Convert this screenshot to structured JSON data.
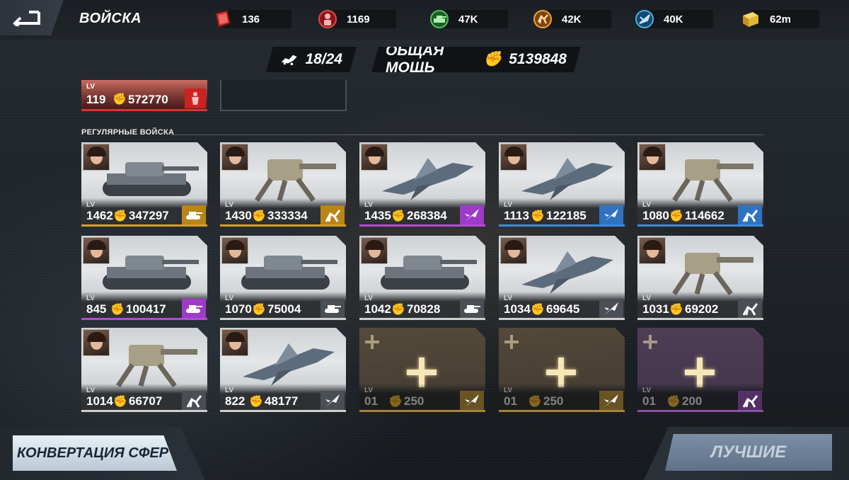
{
  "header": {
    "title": "ВОЙСКА",
    "resources": [
      {
        "name": "red-cube-resource",
        "value": "136",
        "color": "#d23b3b"
      },
      {
        "name": "red-soldier-resource",
        "value": "1169",
        "color": "#c8282e"
      },
      {
        "name": "green-tank-resource",
        "value": "47K",
        "color": "#2f9c3a"
      },
      {
        "name": "orange-mech-resource",
        "value": "42K",
        "color": "#d9851e"
      },
      {
        "name": "blue-jet-resource",
        "value": "40K",
        "color": "#2b8fd0"
      },
      {
        "name": "gold-box-resource",
        "value": "62m",
        "color": "#e0b53a"
      }
    ]
  },
  "summary": {
    "capacity": "18/24",
    "power_label": "ОБЩАЯ МОЩЬ",
    "power_value": "5139848"
  },
  "top_card": {
    "lvl_label": "LV",
    "level": "119",
    "power": "572770",
    "rarity": "red"
  },
  "section": {
    "label": "РЕГУЛЯРНЫЕ ВОЙСКА"
  },
  "units": [
    {
      "lvl_label": "LV",
      "level": "1462",
      "power": "347297",
      "rarity": "gold",
      "type": "tank-icon"
    },
    {
      "lvl_label": "LV",
      "level": "1430",
      "power": "333334",
      "rarity": "gold",
      "type": "mech-icon"
    },
    {
      "lvl_label": "LV",
      "level": "1435",
      "power": "268384",
      "rarity": "purple",
      "type": "jet-icon"
    },
    {
      "lvl_label": "LV",
      "level": "1113",
      "power": "122185",
      "rarity": "blue",
      "type": "jet-icon"
    },
    {
      "lvl_label": "LV",
      "level": "1080",
      "power": "114662",
      "rarity": "blue",
      "type": "mech-icon"
    },
    {
      "lvl_label": "LV",
      "level": "845",
      "power": "100417",
      "rarity": "purple",
      "type": "tank-icon"
    },
    {
      "lvl_label": "LV",
      "level": "1070",
      "power": "75004",
      "rarity": "gray",
      "type": "tank-icon"
    },
    {
      "lvl_label": "LV",
      "level": "1042",
      "power": "70828",
      "rarity": "gray",
      "type": "tank-icon"
    },
    {
      "lvl_label": "LV",
      "level": "1034",
      "power": "69645",
      "rarity": "gray",
      "type": "jet-icon"
    },
    {
      "lvl_label": "LV",
      "level": "1031",
      "power": "69202",
      "rarity": "gray",
      "type": "mech-icon"
    },
    {
      "lvl_label": "LV",
      "level": "1014",
      "power": "66707",
      "rarity": "gray",
      "type": "mech-icon"
    },
    {
      "lvl_label": "LV",
      "level": "822",
      "power": "48177",
      "rarity": "gray",
      "type": "jet-icon"
    }
  ],
  "empty_slots": [
    {
      "lvl_label": "LV",
      "level": "01",
      "power": "250",
      "rarity": "gold",
      "type": "jet-icon"
    },
    {
      "lvl_label": "LV",
      "level": "01",
      "power": "250",
      "rarity": "gold",
      "type": "jet-icon"
    },
    {
      "lvl_label": "LV",
      "level": "01",
      "power": "200",
      "rarity": "purple",
      "type": "mech-icon"
    }
  ],
  "buttons": {
    "convert": "КОНВЕРТАЦИЯ СФЕР",
    "best": "ЛУЧШИЕ"
  }
}
